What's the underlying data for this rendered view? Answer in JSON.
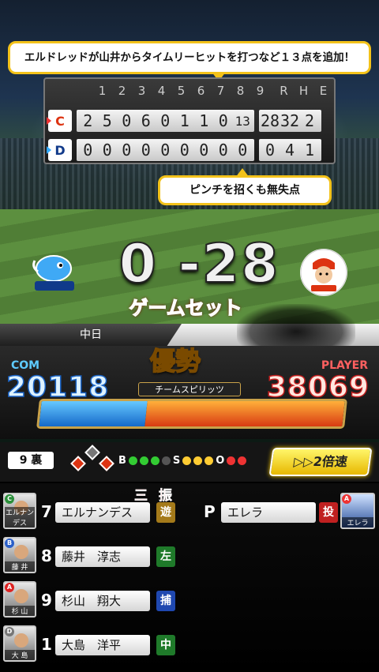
{
  "commentary": {
    "top": "エルドレッドが山井からタイムリーヒットを打つなど１３点を追加！",
    "pitcher_note": "ピンチを招くも無失点"
  },
  "scoreboard": {
    "innings": [
      "1",
      "2",
      "3",
      "4",
      "5",
      "6",
      "7",
      "8",
      "9"
    ],
    "rhe_labels": [
      "R",
      "H",
      "E"
    ],
    "away": {
      "logo": "C",
      "scores": [
        "2",
        "5",
        "0",
        "6",
        "0",
        "1",
        "1",
        "0",
        "13"
      ],
      "rhe": [
        "28",
        "32",
        "2"
      ]
    },
    "home": {
      "logo": "D",
      "scores": [
        "0",
        "0",
        "0",
        "0",
        "0",
        "0",
        "0",
        "0",
        "0"
      ],
      "rhe": [
        "0",
        "4",
        "1"
      ]
    }
  },
  "final": {
    "score": "0 -28",
    "result": "ゲームセット",
    "team_left": "中日"
  },
  "power": {
    "advantage": "優勢",
    "spirit_label": "チームスピリッツ",
    "com_label": "COM",
    "com_value": "20118",
    "player_label": "PLAYER",
    "player_value": "38069",
    "com_share": 0.35
  },
  "status": {
    "inning": "9 裏",
    "b_label": "B",
    "s_label": "S",
    "o_label": "O",
    "balls": 0,
    "strikes": 0,
    "outs": 2,
    "speed_button": "▷▷2倍速"
  },
  "result_text": "三 振",
  "lineup": [
    {
      "badge": "C",
      "badge_color": "#2a8f3a",
      "avatar_name": "エルナンデス",
      "order": "7",
      "name": "エルナンデス",
      "pos": "遊",
      "pos_color": "#a47a1a"
    },
    {
      "badge": "B",
      "badge_color": "#2a5fc9",
      "avatar_name": "藤 井",
      "order": "8",
      "name": "藤井　淳志",
      "pos": "左",
      "pos_color": "#1f7a2a"
    },
    {
      "badge": "A",
      "badge_color": "#d22",
      "avatar_name": "杉 山",
      "order": "9",
      "name": "杉山　翔大",
      "pos": "捕",
      "pos_color": "#1f48b0"
    },
    {
      "badge": "D",
      "badge_color": "#777",
      "avatar_name": "大 島",
      "order": "1",
      "name": "大島　洋平",
      "pos": "中",
      "pos_color": "#1f7a2a"
    }
  ],
  "pitcher": {
    "label": "P",
    "name": "エレラ",
    "pos": "投",
    "badge": "A",
    "avatar_name": "エレラ"
  }
}
